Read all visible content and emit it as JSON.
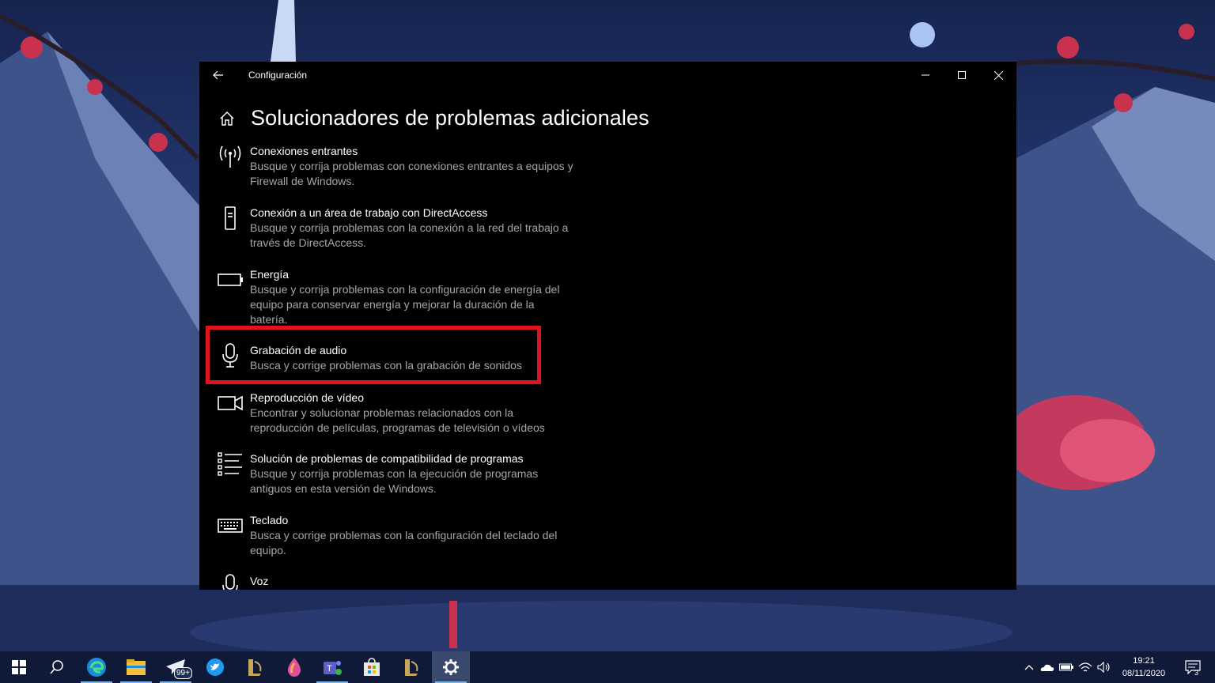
{
  "window": {
    "title": "Configuración",
    "page_title": "Solucionadores de problemas adicionales"
  },
  "items": [
    {
      "icon": "antenna-icon",
      "title": "Conexiones entrantes",
      "desc": "Busque y corrija problemas con conexiones entrantes a equipos y Firewall de Windows."
    },
    {
      "icon": "device-icon",
      "title": "Conexión a un área de trabajo con DirectAccess",
      "desc": "Busque y corrija problemas con la conexión a la red del trabajo a través de DirectAccess."
    },
    {
      "icon": "battery-icon",
      "title": "Energía",
      "desc": "Busque y corrija problemas con la configuración de energía del equipo para conservar energía y mejorar la duración de la batería."
    },
    {
      "icon": "microphone-icon",
      "title": "Grabación de audio",
      "desc": "Busca y corrige problemas con la grabación de sonidos"
    },
    {
      "icon": "video-camera-icon",
      "title": "Reproducción de vídeo",
      "desc": "Encontrar y solucionar problemas relacionados con la reproducción de películas, programas de televisión o vídeos"
    },
    {
      "icon": "list-icon",
      "title": "Solución de problemas de compatibilidad de programas",
      "desc": "Busque y corrija problemas con la ejecución de programas antiguos en esta versión de Windows."
    },
    {
      "icon": "keyboard-icon",
      "title": "Teclado",
      "desc": "Busca y corrige problemas con la configuración del teclado del equipo."
    },
    {
      "icon": "microphone-icon",
      "title": "Voz",
      "desc": ""
    }
  ],
  "taskbar": {
    "apps": [
      "start-icon",
      "search-icon",
      "edge-icon",
      "file-explorer-icon",
      "telegram-icon",
      "twitter-icon",
      "lol-icon",
      "paint-icon",
      "teams-icon",
      "store-icon",
      "lol-icon",
      "settings-icon"
    ],
    "telegram_badge": "99+",
    "time": "19:21",
    "date": "08/11/2020",
    "notification_count": "3"
  },
  "colors": {
    "highlight": "#e0131f",
    "window_bg": "#000000",
    "desc_text": "#a6a6a6"
  }
}
